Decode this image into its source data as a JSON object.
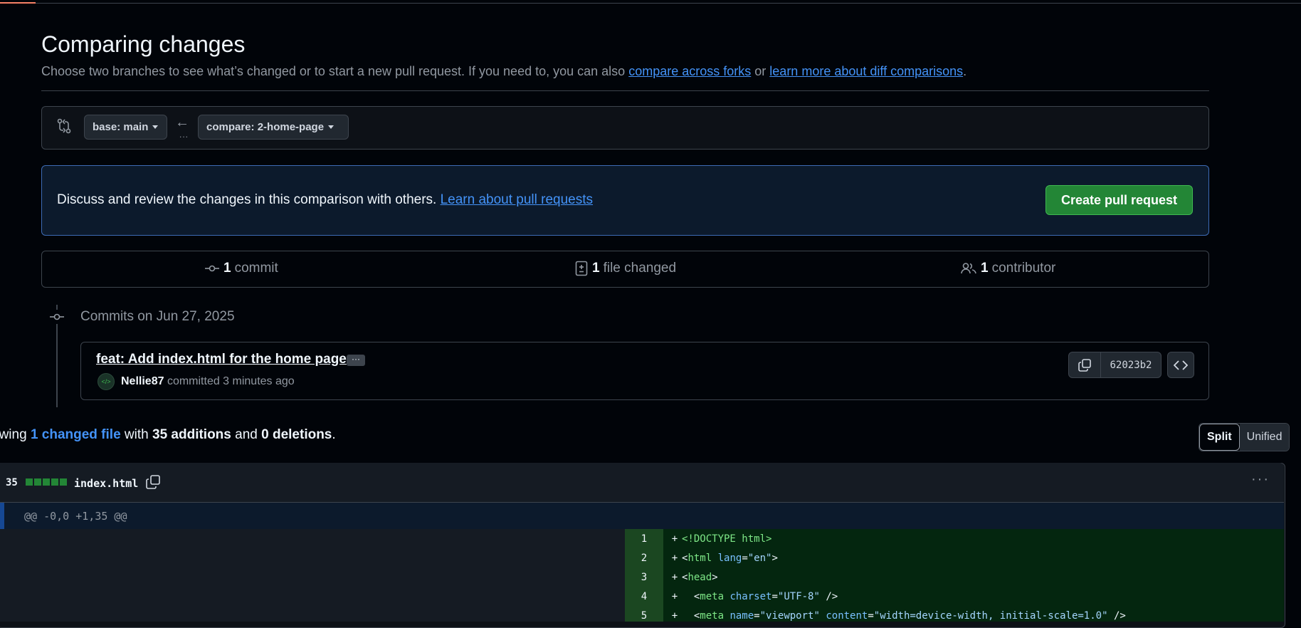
{
  "page": {
    "title": "Comparing changes",
    "subtitle_text": "Choose two branches to see what’s changed or to start a new pull request. If you need to, you can also",
    "subtitle_link1": "compare across forks",
    "subtitle_or": "or",
    "subtitle_link2": "learn more about diff comparisons",
    "subtitle_end": "."
  },
  "range": {
    "base_label": "base: main",
    "compare_label": "compare: 2-home-page",
    "arrow_dots": "..."
  },
  "flash": {
    "text": "Discuss and review the changes in this comparison with others.",
    "link": "Learn about pull requests",
    "button": "Create pull request"
  },
  "stats": {
    "commits_count": "1",
    "commits_label": "commit",
    "files_count": "1",
    "files_label": "file changed",
    "contributors_count": "1",
    "contributors_label": "contributor"
  },
  "commits": {
    "date_heading": "Commits on Jun 27, 2025",
    "items": [
      {
        "message": "feat: Add index.html for the home page",
        "ellipsis": "···",
        "author": "Nellie87",
        "action": "committed 3 minutes ago",
        "sha": "62023b2"
      }
    ]
  },
  "summary": {
    "prefix": "owing",
    "changed_files": "1 changed file",
    "with": "with",
    "additions": "35 additions",
    "and": "and",
    "deletions": "0 deletions",
    "end": "."
  },
  "view_toggle": {
    "split": "Split",
    "unified": "Unified",
    "selected": "Split"
  },
  "file": {
    "changes": "35",
    "name": "index.html",
    "hunk_header": "@@ -0,0 +1,35 @@",
    "lines": [
      {
        "num": "1",
        "sign": "+",
        "parts": [
          {
            "t": "tag",
            "v": "<!DOCTYPE html>"
          }
        ]
      },
      {
        "num": "2",
        "sign": "+",
        "parts": [
          {
            "t": "txt",
            "v": "<"
          },
          {
            "t": "tag",
            "v": "html"
          },
          {
            "t": "txt",
            "v": " "
          },
          {
            "t": "attr",
            "v": "lang"
          },
          {
            "t": "txt",
            "v": "="
          },
          {
            "t": "str",
            "v": "\"en\""
          },
          {
            "t": "txt",
            "v": ">"
          }
        ]
      },
      {
        "num": "3",
        "sign": "+",
        "parts": [
          {
            "t": "txt",
            "v": "<"
          },
          {
            "t": "tag",
            "v": "head"
          },
          {
            "t": "txt",
            "v": ">"
          }
        ]
      },
      {
        "num": "4",
        "sign": "+",
        "parts": [
          {
            "t": "txt",
            "v": "  <"
          },
          {
            "t": "tag",
            "v": "meta"
          },
          {
            "t": "txt",
            "v": " "
          },
          {
            "t": "attr",
            "v": "charset"
          },
          {
            "t": "txt",
            "v": "="
          },
          {
            "t": "str",
            "v": "\"UTF-8\""
          },
          {
            "t": "txt",
            "v": " />"
          }
        ]
      },
      {
        "num": "5",
        "sign": "+",
        "parts": [
          {
            "t": "txt",
            "v": "  <"
          },
          {
            "t": "tag",
            "v": "meta"
          },
          {
            "t": "txt",
            "v": " "
          },
          {
            "t": "attr",
            "v": "name"
          },
          {
            "t": "txt",
            "v": "="
          },
          {
            "t": "str",
            "v": "\"viewport\""
          },
          {
            "t": "txt",
            "v": " "
          },
          {
            "t": "attr",
            "v": "content"
          },
          {
            "t": "txt",
            "v": "="
          },
          {
            "t": "str",
            "v": "\"width=device-width, initial-scale=1.0\""
          },
          {
            "t": "txt",
            "v": " />"
          }
        ]
      }
    ]
  },
  "colors": {
    "accent_link": "#4493f8",
    "primary_button": "#238636",
    "added_line_bg": "#04260f",
    "added_gutter_bg": "#1b4721"
  }
}
